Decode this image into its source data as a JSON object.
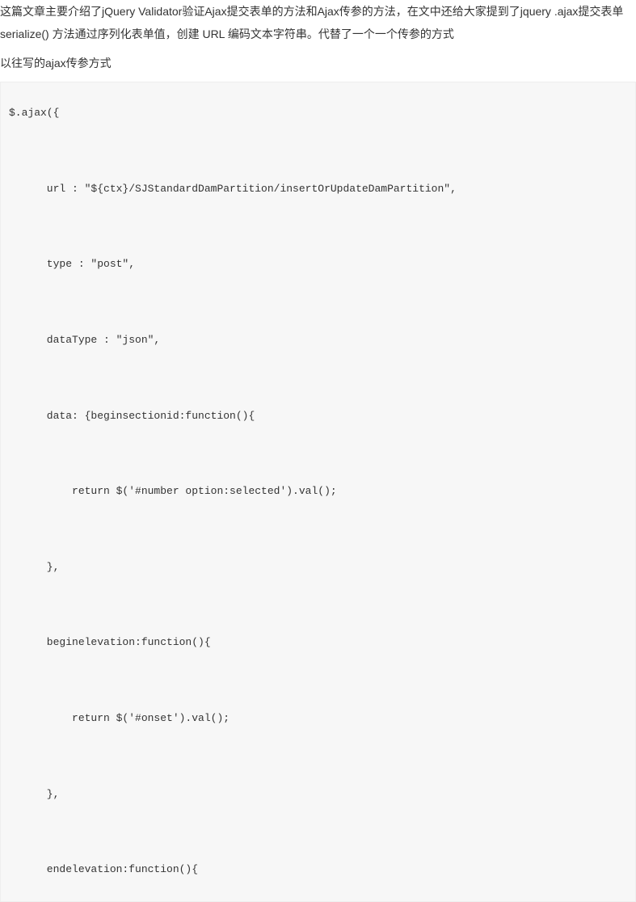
{
  "article": {
    "intro": "这篇文章主要介绍了jQuery Validator验证Ajax提交表单的方法和Ajax传参的方法，在文中还给大家提到了jquery .ajax提交表单 serialize() 方法通过序列化表单值，创建 URL 编码文本字符串。代替了一个一个传参的方式",
    "sub": "以往写的ajax传参方式"
  },
  "code": {
    "line1": "$.ajax({",
    "line2": "      url : \"${ctx}/SJStandardDamPartition/insertOrUpdateDamPartition\",",
    "line3": "      type : \"post\",",
    "line4": "      dataType : \"json\",",
    "line5": "      data: {beginsectionid:function(){",
    "line6": "          return $('#number option:selected').val();",
    "line7": "      },",
    "line8": "      beginelevation:function(){",
    "line9": "          return $('#onset').val();",
    "line10": "      },",
    "line11": "      endelevation:function(){"
  }
}
